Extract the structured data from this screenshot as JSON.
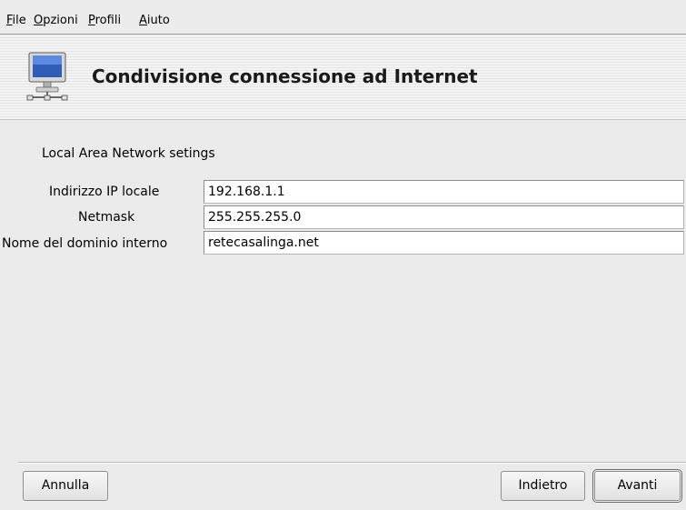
{
  "menu": {
    "items": [
      {
        "mnemonic": "F",
        "rest": "ile"
      },
      {
        "mnemonic": "O",
        "rest": "pzioni"
      },
      {
        "mnemonic": "P",
        "rest": "rofili"
      },
      {
        "mnemonic": "A",
        "rest": "iuto"
      }
    ]
  },
  "header": {
    "icon": "computer-network-icon",
    "title": "Condivisione connessione ad Internet"
  },
  "form": {
    "section_label": "Local Area Network setings",
    "fields": [
      {
        "label": "Indirizzo IP locale",
        "value": "192.168.1.1"
      },
      {
        "label": "Netmask",
        "value": "255.255.255.0"
      },
      {
        "label": "Nome del dominio interno",
        "value": "retecasalinga.net"
      }
    ]
  },
  "buttons": {
    "cancel": "Annulla",
    "back": "Indietro",
    "next": "Avanti"
  }
}
